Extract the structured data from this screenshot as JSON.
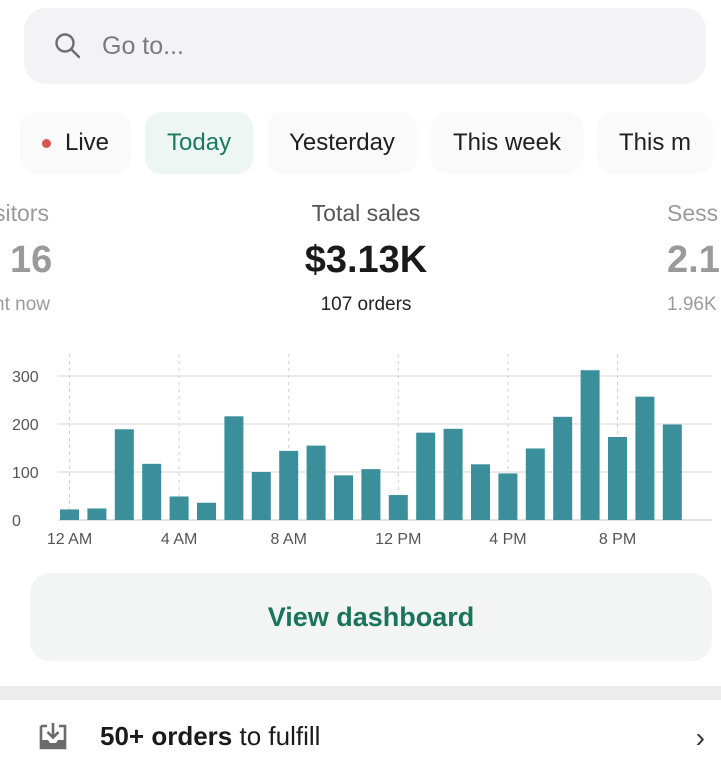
{
  "search": {
    "placeholder": "Go to...",
    "icon": "search-icon"
  },
  "tabs": [
    {
      "label": "Live",
      "live_dot_color": "#d9534f"
    },
    {
      "label": "Today",
      "active": true
    },
    {
      "label": "Yesterday"
    },
    {
      "label": "This week"
    },
    {
      "label": "This m"
    }
  ],
  "metrics": {
    "visitors": {
      "label": "sitors",
      "value": "16",
      "sub": "ht now"
    },
    "total_sales": {
      "label": "Total sales",
      "value": "$3.13K",
      "sub": "107 orders"
    },
    "sessions": {
      "label": "Sess",
      "value": "2.1",
      "sub": "1.96K"
    }
  },
  "chart_data": {
    "type": "bar",
    "title": "",
    "xlabel": "",
    "ylabel": "",
    "ylim": [
      0,
      300
    ],
    "yticks": [
      0,
      100,
      200,
      300
    ],
    "xtick_labels": [
      "12 AM",
      "4 AM",
      "8 AM",
      "12 PM",
      "4 PM",
      "8 PM"
    ],
    "xtick_indices": [
      0,
      4,
      8,
      12,
      16,
      20
    ],
    "categories": [
      "12 AM",
      "1 AM",
      "2 AM",
      "3 AM",
      "4 AM",
      "5 AM",
      "6 AM",
      "7 AM",
      "8 AM",
      "9 AM",
      "10 AM",
      "11 AM",
      "12 PM",
      "1 PM",
      "2 PM",
      "3 PM",
      "4 PM",
      "5 PM",
      "6 PM",
      "7 PM",
      "8 PM",
      "9 PM",
      "10 PM"
    ],
    "values": [
      22,
      24,
      189,
      117,
      49,
      36,
      216,
      100,
      144,
      155,
      93,
      106,
      52,
      182,
      190,
      116,
      97,
      149,
      215,
      312,
      173,
      257,
      199
    ],
    "bar_color": "#3a8f9b",
    "grid": true
  },
  "dashboard_button": {
    "label": "View dashboard",
    "color": "#1b7558"
  },
  "task": {
    "bold": "50+ orders",
    "rest": " to fulfill",
    "icon": "inbox-download-icon"
  }
}
